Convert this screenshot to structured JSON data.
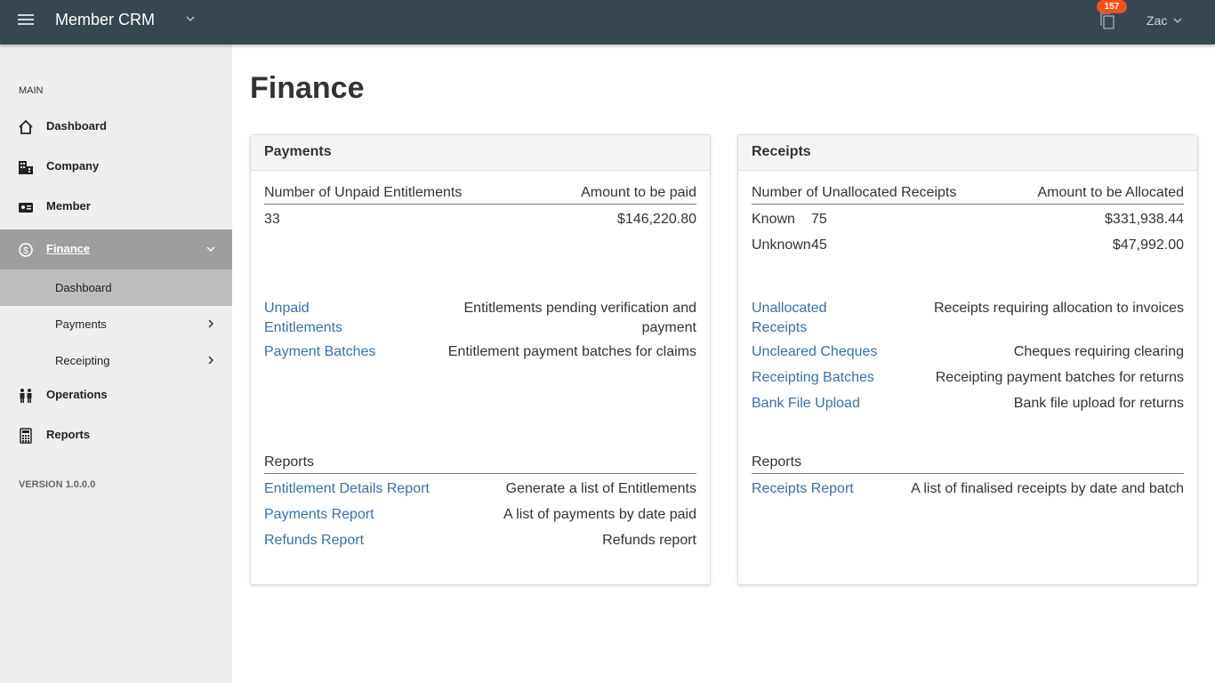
{
  "header": {
    "app_title": "Member CRM",
    "notification_count": "157",
    "user_name": "Zac"
  },
  "sidebar": {
    "section_label": "MAIN",
    "items": [
      {
        "label": "Dashboard",
        "icon": "home-icon"
      },
      {
        "label": "Company",
        "icon": "building-icon"
      },
      {
        "label": "Member",
        "icon": "id-card-icon"
      },
      {
        "label": "Finance",
        "icon": "dollar-circle-icon",
        "active": true
      },
      {
        "label": "Operations",
        "icon": "people-icon"
      },
      {
        "label": "Reports",
        "icon": "calculator-icon"
      }
    ],
    "finance_sub": [
      {
        "label": "Dashboard",
        "active": true
      },
      {
        "label": "Payments"
      },
      {
        "label": "Receipting"
      }
    ],
    "version": "VERSION 1.0.0.0"
  },
  "main": {
    "page_title": "Finance",
    "payments": {
      "title": "Payments",
      "summary_left_header": "Number of Unpaid Entitlements",
      "summary_right_header": "Amount to be paid",
      "unpaid_count": "33",
      "unpaid_amount": "$146,220.80",
      "links": [
        {
          "label_line1": "Unpaid",
          "label_line2": "Entitlements",
          "desc_line1": "Entitlements pending verification and",
          "desc_line2": "payment"
        },
        {
          "label": "Payment Batches",
          "desc": "Entitlement payment batches for claims"
        }
      ],
      "reports_header": "Reports",
      "reports": [
        {
          "label": "Entitlement Details Report",
          "desc": "Generate a list of Entitlements"
        },
        {
          "label": "Payments Report",
          "desc": "A list of payments by date paid"
        },
        {
          "label": "Refunds Report",
          "desc": "Refunds report"
        }
      ]
    },
    "receipts": {
      "title": "Receipts",
      "summary_left_header": "Number of Unallocated Receipts",
      "summary_right_header": "Amount to be Allocated",
      "known_label": "Known",
      "known_count": "75",
      "known_amount": "$331,938.44",
      "unknown_label": "Unknown",
      "unknown_count": "45",
      "unknown_amount": "$47,992.00",
      "links": [
        {
          "label_line1": "Unallocated",
          "label_line2": "Receipts",
          "desc": "Receipts requiring allocation to invoices"
        },
        {
          "label": "Uncleared Cheques",
          "desc": "Cheques requiring clearing"
        },
        {
          "label": "Receipting Batches",
          "desc": "Receipting payment batches for returns"
        },
        {
          "label": "Bank File Upload",
          "desc": "Bank file upload for returns"
        }
      ],
      "reports_header": "Reports",
      "reports": [
        {
          "label": "Receipts Report",
          "desc": "A list of finalised receipts by date and batch"
        }
      ]
    }
  },
  "colors": {
    "topbar": "#37474f",
    "sidebar": "#eeeeee",
    "active_nav": "#9e9e9e",
    "active_sub": "#bdbdbd",
    "link": "#3a6fa8",
    "badge": "#f4511e"
  }
}
